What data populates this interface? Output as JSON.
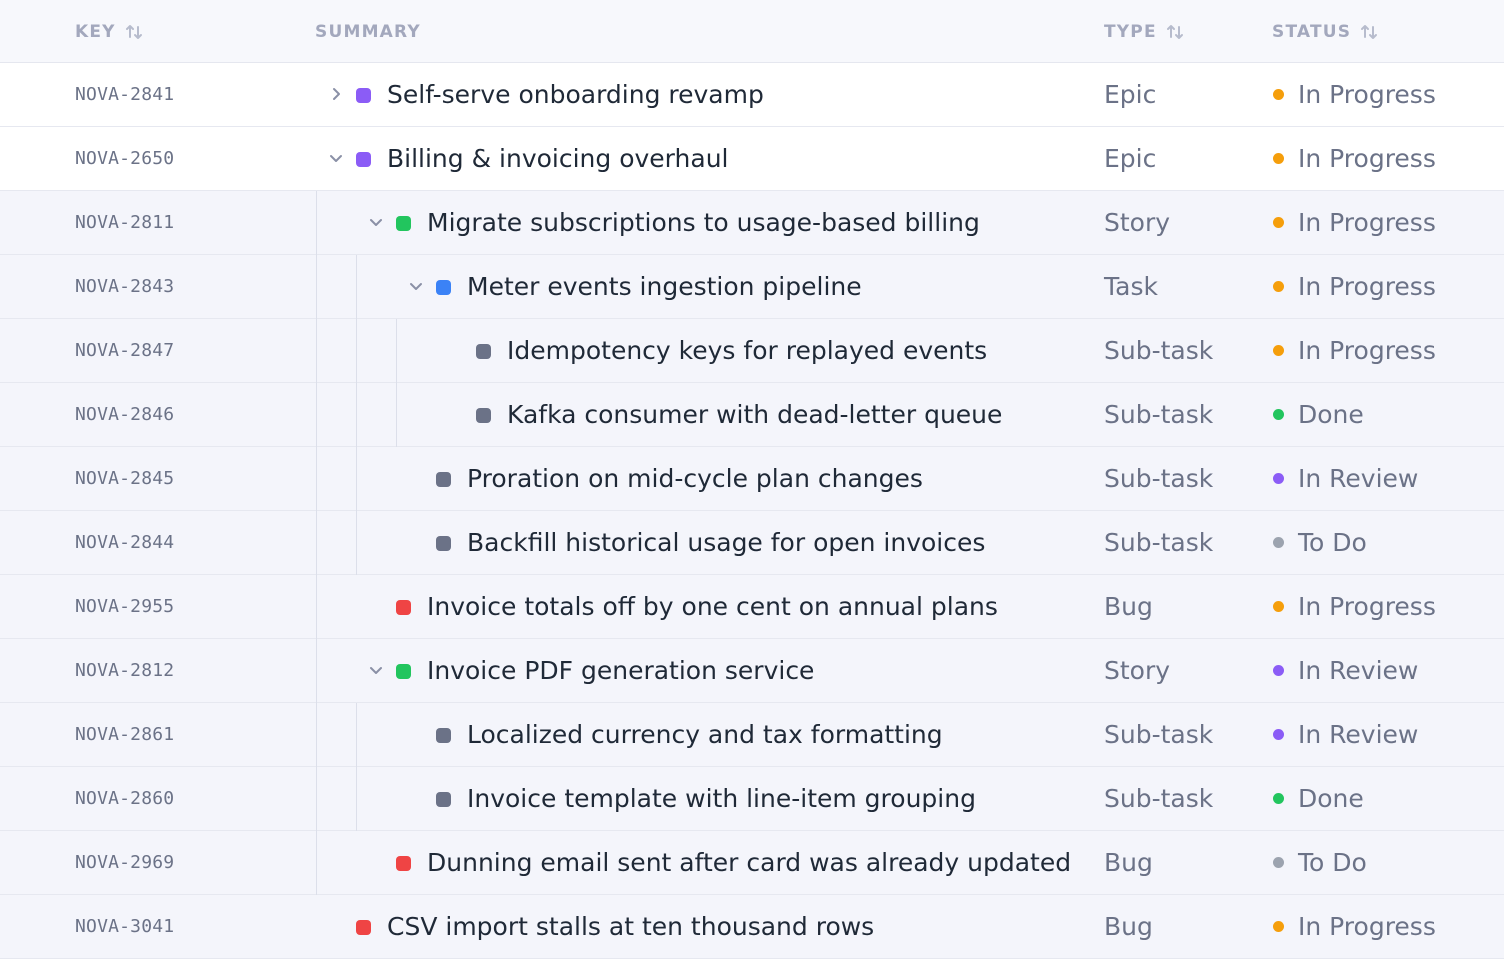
{
  "columns": {
    "key": "KEY",
    "summary": "SUMMARY",
    "type": "TYPE",
    "status": "STATUS"
  },
  "colors": {
    "epic": "#8b5cf6",
    "story": "#22c55e",
    "task": "#3b82f6",
    "subtask": "#6b7287",
    "bug": "#ef4444",
    "in_progress": "#f59e0b",
    "done": "#22c55e",
    "in_review": "#8b5cf6",
    "to_do": "#9ca3af"
  },
  "rows": [
    {
      "key": "NOVA-2841",
      "summary": "Self-serve onboarding revamp",
      "type": "Epic",
      "status": "In Progress",
      "level": 0,
      "chevron": "right",
      "kind": "epic",
      "statusKind": "in_progress"
    },
    {
      "key": "NOVA-2650",
      "summary": "Billing & invoicing overhaul",
      "type": "Epic",
      "status": "In Progress",
      "level": 0,
      "chevron": "down",
      "kind": "epic",
      "statusKind": "in_progress"
    },
    {
      "key": "NOVA-2811",
      "summary": "Migrate subscriptions to usage-based billing",
      "type": "Story",
      "status": "In Progress",
      "level": 1,
      "chevron": "down",
      "kind": "story",
      "statusKind": "in_progress"
    },
    {
      "key": "NOVA-2843",
      "summary": "Meter events ingestion pipeline",
      "type": "Task",
      "status": "In Progress",
      "level": 2,
      "chevron": "down",
      "kind": "task",
      "statusKind": "in_progress"
    },
    {
      "key": "NOVA-2847",
      "summary": "Idempotency keys for replayed events",
      "type": "Sub-task",
      "status": "In Progress",
      "level": 3,
      "chevron": "",
      "kind": "subtask",
      "statusKind": "in_progress"
    },
    {
      "key": "NOVA-2846",
      "summary": "Kafka consumer with dead-letter queue",
      "type": "Sub-task",
      "status": "Done",
      "level": 3,
      "chevron": "",
      "kind": "subtask",
      "statusKind": "done"
    },
    {
      "key": "NOVA-2845",
      "summary": "Proration on mid-cycle plan changes",
      "type": "Sub-task",
      "status": "In Review",
      "level": 2,
      "chevron": "",
      "kind": "subtask",
      "statusKind": "in_review"
    },
    {
      "key": "NOVA-2844",
      "summary": "Backfill historical usage for open invoices",
      "type": "Sub-task",
      "status": "To Do",
      "level": 2,
      "chevron": "",
      "kind": "subtask",
      "statusKind": "to_do"
    },
    {
      "key": "NOVA-2955",
      "summary": "Invoice totals off by one cent on annual plans",
      "type": "Bug",
      "status": "In Progress",
      "level": 1,
      "chevron": "",
      "kind": "bug",
      "statusKind": "in_progress"
    },
    {
      "key": "NOVA-2812",
      "summary": "Invoice PDF generation service",
      "type": "Story",
      "status": "In Review",
      "level": 1,
      "chevron": "down",
      "kind": "story",
      "statusKind": "in_review"
    },
    {
      "key": "NOVA-2861",
      "summary": "Localized currency and tax formatting",
      "type": "Sub-task",
      "status": "In Review",
      "level": 2,
      "chevron": "",
      "kind": "subtask",
      "statusKind": "in_review"
    },
    {
      "key": "NOVA-2860",
      "summary": "Invoice template with line-item grouping",
      "type": "Sub-task",
      "status": "Done",
      "level": 2,
      "chevron": "",
      "kind": "subtask",
      "statusKind": "done"
    },
    {
      "key": "NOVA-2969",
      "summary": "Dunning email sent after card was already updated",
      "type": "Bug",
      "status": "To Do",
      "level": 1,
      "chevron": "",
      "kind": "bug",
      "statusKind": "to_do"
    },
    {
      "key": "NOVA-3041",
      "summary": "CSV import stalls at ten thousand rows",
      "type": "Bug",
      "status": "In Progress",
      "level": 0,
      "chevron": "",
      "kind": "bug",
      "statusKind": "in_progress"
    }
  ]
}
